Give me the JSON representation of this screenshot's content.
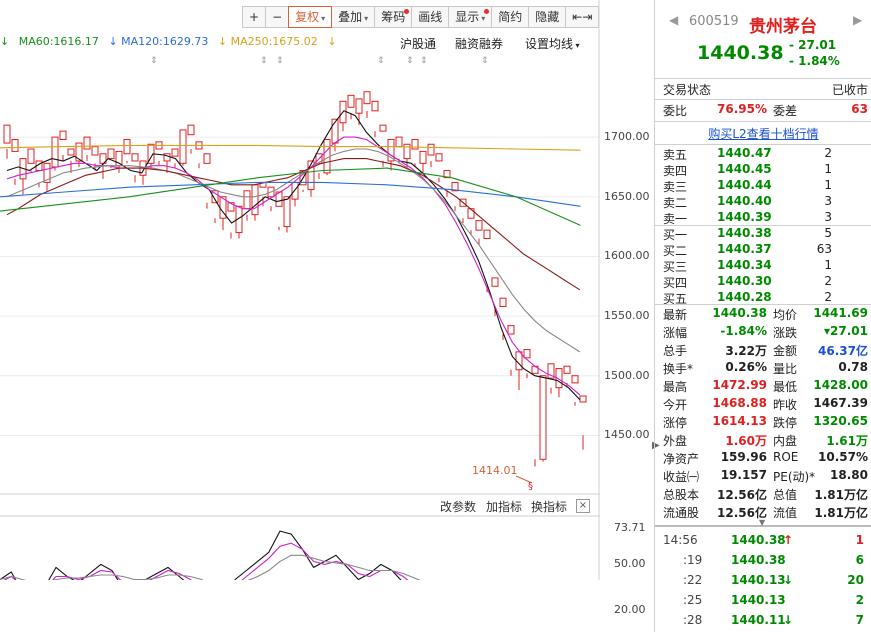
{
  "toolbar": {
    "buttons": [
      {
        "label": "+",
        "arrow": false,
        "dot": false,
        "selected": false
      },
      {
        "label": "−",
        "arrow": false,
        "dot": false,
        "selected": false
      },
      {
        "label": "复权",
        "arrow": true,
        "dot": false,
        "selected": true
      },
      {
        "label": "叠加",
        "arrow": true,
        "dot": false,
        "selected": false
      },
      {
        "label": "筹码",
        "arrow": false,
        "dot": true,
        "selected": false
      },
      {
        "label": "画线",
        "arrow": false,
        "dot": false,
        "selected": false
      },
      {
        "label": "显示",
        "arrow": true,
        "dot": true,
        "selected": false
      },
      {
        "label": "简约",
        "arrow": false,
        "dot": false,
        "selected": false
      },
      {
        "label": "隐藏",
        "arrow": false,
        "dot": false,
        "selected": false
      },
      {
        "label": "⇤⇥",
        "arrow": false,
        "dot": false,
        "selected": false
      }
    ]
  },
  "ma": {
    "ma60": "MA60:1616.17",
    "ma120": "MA120:1629.73",
    "ma250": "MA250:1675.02",
    "ma120_arrow": "↓",
    "ma250_arrow": "↓",
    "colors": {
      "ma60": "#1a8f1a",
      "ma120": "#2b6fd6",
      "ma250": "#d9a21a"
    }
  },
  "links": {
    "hugutong": "沪股通",
    "rongzi": "融资融券",
    "setting": "设置均线"
  },
  "sub_toolbar": {
    "params": "改参数",
    "add": "加指标",
    "switch": "换指标",
    "close": "×"
  },
  "chart_data": [
    {
      "type": "candlestick",
      "title": "",
      "ylim": [
        1414,
        1733
      ],
      "y_ticks": [
        "1700.00",
        "1650.00",
        "1600.00",
        "1550.00",
        "1500.00",
        "1450.00"
      ],
      "annotation": "1414.01",
      "candles": [
        [
          1685,
          1700,
          1672,
          1680
        ],
        [
          1678,
          1688,
          1650,
          1655
        ],
        [
          1655,
          1672,
          1642,
          1668
        ],
        [
          1668,
          1680,
          1660,
          1662
        ],
        [
          1662,
          1670,
          1648,
          1652
        ],
        [
          1652,
          1668,
          1645,
          1665
        ],
        [
          1665,
          1690,
          1662,
          1688
        ],
        [
          1688,
          1695,
          1670,
          1675
        ],
        [
          1675,
          1680,
          1660,
          1670
        ],
        [
          1670,
          1685,
          1665,
          1680
        ],
        [
          1680,
          1690,
          1670,
          1675
        ],
        [
          1675,
          1682,
          1662,
          1668
        ],
        [
          1668,
          1676,
          1655,
          1672
        ],
        [
          1672,
          1680,
          1664,
          1666
        ],
        [
          1666,
          1678,
          1660,
          1676
        ],
        [
          1676,
          1688,
          1668,
          1670
        ],
        [
          1670,
          1676,
          1652,
          1658
        ],
        [
          1658,
          1670,
          1650,
          1668
        ],
        [
          1668,
          1684,
          1664,
          1680
        ],
        [
          1680,
          1686,
          1666,
          1670
        ],
        [
          1670,
          1676,
          1660,
          1674
        ],
        [
          1674,
          1680,
          1664,
          1668
        ],
        [
          1668,
          1696,
          1666,
          1692
        ],
        [
          1692,
          1700,
          1676,
          1680
        ],
        [
          1680,
          1686,
          1664,
          1668
        ],
        [
          1668,
          1676,
          1630,
          1635
        ],
        [
          1635,
          1645,
          1618,
          1622
        ],
        [
          1622,
          1640,
          1612,
          1628
        ],
        [
          1628,
          1635,
          1605,
          1610
        ],
        [
          1610,
          1632,
          1605,
          1630
        ],
        [
          1630,
          1645,
          1620,
          1625
        ],
        [
          1625,
          1650,
          1620,
          1648
        ],
        [
          1648,
          1652,
          1632,
          1640
        ],
        [
          1640,
          1648,
          1628,
          1632
        ],
        [
          1632,
          1644,
          1612,
          1615
        ],
        [
          1615,
          1640,
          1610,
          1638
        ],
        [
          1638,
          1652,
          1632,
          1650
        ],
        [
          1650,
          1662,
          1644,
          1646
        ],
        [
          1646,
          1670,
          1640,
          1668
        ],
        [
          1668,
          1676,
          1655,
          1660
        ],
        [
          1660,
          1688,
          1658,
          1685
        ],
        [
          1685,
          1705,
          1678,
          1702
        ],
        [
          1702,
          1720,
          1695,
          1715
        ],
        [
          1715,
          1725,
          1705,
          1710
        ],
        [
          1710,
          1722,
          1700,
          1718
        ],
        [
          1718,
          1728,
          1706,
          1712
        ],
        [
          1712,
          1720,
          1690,
          1695
        ],
        [
          1695,
          1700,
          1665,
          1670
        ],
        [
          1670,
          1688,
          1662,
          1682
        ],
        [
          1682,
          1690,
          1668,
          1672
        ],
        [
          1672,
          1684,
          1664,
          1680
        ],
        [
          1680,
          1688,
          1665,
          1668
        ],
        [
          1668,
          1678,
          1660,
          1675
        ],
        [
          1675,
          1684,
          1665,
          1670
        ],
        [
          1670,
          1676,
          1652,
          1656
        ],
        [
          1656,
          1662,
          1640,
          1645
        ],
        [
          1645,
          1652,
          1628,
          1632
        ],
        [
          1632,
          1638,
          1618,
          1622
        ],
        [
          1622,
          1630,
          1608,
          1612
        ],
        [
          1612,
          1620,
          1600,
          1605
        ],
        [
          1605,
          1612,
          1560,
          1565
        ],
        [
          1565,
          1572,
          1540,
          1548
        ],
        [
          1548,
          1555,
          1520,
          1525
        ],
        [
          1525,
          1532,
          1490,
          1495
        ],
        [
          1495,
          1510,
          1478,
          1505
        ],
        [
          1505,
          1512,
          1488,
          1492
        ],
        [
          1492,
          1498,
          1414,
          1420
        ],
        [
          1420,
          1490,
          1418,
          1488
        ],
        [
          1488,
          1500,
          1475,
          1480
        ],
        [
          1480,
          1496,
          1472,
          1492
        ],
        [
          1492,
          1498,
          1480,
          1484
        ],
        [
          1484,
          1490,
          1465,
          1468
        ],
        [
          1468,
          1473,
          1428,
          1440
        ]
      ],
      "lines": [
        {
          "name": "MA5",
          "color": "#111111",
          "values": [
            1662,
            1665,
            1662,
            1668,
            1672,
            1670,
            1674,
            1668,
            1662,
            1672,
            1668,
            1662,
            1660,
            1676,
            1675,
            1672,
            1660,
            1652,
            1646,
            1630,
            1618,
            1624,
            1632,
            1640,
            1636,
            1638,
            1650,
            1666,
            1684,
            1700,
            1712,
            1708,
            1694,
            1684,
            1676,
            1670,
            1668,
            1660,
            1650,
            1638,
            1624,
            1606,
            1586,
            1560,
            1530,
            1506,
            1496,
            1490,
            1488,
            1486,
            1480,
            1470
          ]
        },
        {
          "name": "MA10",
          "color": "#d020d0",
          "values": [
            1655,
            1658,
            1660,
            1662,
            1664,
            1666,
            1668,
            1668,
            1666,
            1666,
            1664,
            1664,
            1664,
            1666,
            1666,
            1664,
            1660,
            1654,
            1646,
            1640,
            1634,
            1630,
            1630,
            1636,
            1642,
            1648,
            1656,
            1664,
            1674,
            1684,
            1690,
            1690,
            1688,
            1682,
            1676,
            1670,
            1664,
            1656,
            1646,
            1634,
            1618,
            1600,
            1580,
            1558,
            1536,
            1518,
            1506,
            1498,
            1492,
            1488,
            1482,
            1474
          ]
        },
        {
          "name": "MA20",
          "color": "#888888",
          "values": [
            1640,
            1644,
            1648,
            1652,
            1656,
            1660,
            1662,
            1664,
            1665,
            1666,
            1666,
            1666,
            1665,
            1664,
            1662,
            1660,
            1656,
            1652,
            1648,
            1644,
            1642,
            1640,
            1640,
            1642,
            1646,
            1652,
            1658,
            1664,
            1670,
            1675,
            1678,
            1680,
            1680,
            1678,
            1674,
            1668,
            1662,
            1655,
            1646,
            1636,
            1624,
            1612,
            1600,
            1586,
            1572,
            1558,
            1546,
            1536,
            1528,
            1522,
            1516,
            1510
          ]
        },
        {
          "name": "MA30",
          "color": "#8b1a1a",
          "values": [
            1625,
            1630,
            1636,
            1642,
            1646,
            1650,
            1654,
            1658,
            1660,
            1662,
            1664,
            1664,
            1664,
            1663,
            1662,
            1660,
            1658,
            1656,
            1654,
            1652,
            1650,
            1650,
            1650,
            1652,
            1654,
            1656,
            1660,
            1664,
            1668,
            1670,
            1672,
            1672,
            1672,
            1670,
            1668,
            1666,
            1662,
            1658,
            1652,
            1646,
            1640,
            1632,
            1624,
            1616,
            1608,
            1600,
            1592,
            1586,
            1580,
            1574,
            1568,
            1562
          ]
        }
      ]
    },
    {
      "type": "line",
      "title": "",
      "ylim": [
        5,
        80
      ],
      "y_ticks": [
        "73.71",
        "50.00",
        "20.00"
      ],
      "lines": [
        {
          "name": "",
          "color": "#111111",
          "values": [
            40,
            45,
            32,
            28,
            35,
            48,
            42,
            38,
            44,
            50,
            46,
            34,
            30,
            40,
            44,
            48,
            42,
            36,
            28,
            22,
            30,
            40,
            46,
            52,
            58,
            72,
            70,
            60,
            48,
            52,
            56,
            48,
            40,
            44,
            50,
            46,
            38,
            32,
            30,
            34,
            30,
            24,
            18,
            12,
            10,
            14,
            18,
            22,
            26,
            24,
            20,
            14
          ]
        },
        {
          "name": "",
          "color": "#d020d0",
          "values": [
            38,
            42,
            36,
            32,
            34,
            42,
            42,
            40,
            42,
            46,
            45,
            38,
            34,
            38,
            42,
            46,
            44,
            40,
            34,
            28,
            30,
            36,
            42,
            48,
            54,
            62,
            64,
            60,
            52,
            50,
            52,
            50,
            44,
            42,
            46,
            46,
            42,
            36,
            32,
            32,
            30,
            26,
            22,
            18,
            16,
            18,
            20,
            22,
            24,
            24,
            22,
            18
          ]
        },
        {
          "name": "",
          "color": "#888888",
          "values": [
            40,
            42,
            40,
            38,
            38,
            40,
            41,
            41,
            42,
            43,
            43,
            42,
            40,
            40,
            41,
            43,
            43,
            42,
            40,
            36,
            35,
            36,
            39,
            42,
            46,
            52,
            56,
            56,
            54,
            52,
            51,
            50,
            48,
            46,
            46,
            46,
            44,
            41,
            38,
            36,
            34,
            32,
            29,
            27,
            25,
            24,
            24,
            24,
            24,
            24,
            24,
            23
          ]
        }
      ]
    }
  ],
  "quote": {
    "code": "600519",
    "name": "贵州茅台",
    "price": "1440.38",
    "change": "- 27.01",
    "change_pct": "- 1.84%",
    "status_label": "交易状态",
    "status_value": "已收市",
    "webi_label": "委比",
    "webi_value": "76.95%",
    "weicha_label": "委差",
    "weicha_value": "63",
    "l2_link": "购买L2查看十档行情"
  },
  "sells": [
    {
      "label": "卖五",
      "price": "1440.47",
      "vol": "2"
    },
    {
      "label": "卖四",
      "price": "1440.45",
      "vol": "1"
    },
    {
      "label": "卖三",
      "price": "1440.44",
      "vol": "1"
    },
    {
      "label": "卖二",
      "price": "1440.40",
      "vol": "3"
    },
    {
      "label": "卖一",
      "price": "1440.39",
      "vol": "3"
    }
  ],
  "buys": [
    {
      "label": "买一",
      "price": "1440.38",
      "vol": "5"
    },
    {
      "label": "买二",
      "price": "1440.37",
      "vol": "63"
    },
    {
      "label": "买三",
      "price": "1440.34",
      "vol": "1"
    },
    {
      "label": "买四",
      "price": "1440.30",
      "vol": "2"
    },
    {
      "label": "买五",
      "price": "1440.28",
      "vol": "2"
    }
  ],
  "stats": [
    {
      "l1": "最新",
      "v1": "1440.38",
      "c1": "green",
      "l2": "均价",
      "v2": "1441.69",
      "c2": "green"
    },
    {
      "l1": "涨幅",
      "v1": "-1.84%",
      "c1": "green",
      "l2": "涨跌",
      "v2": "▾27.01",
      "c2": "green"
    },
    {
      "l1": "总手",
      "v1": "3.22万",
      "c1": "black",
      "l2": "金额",
      "v2": "46.37亿",
      "c2": "blue"
    },
    {
      "l1": "换手*",
      "v1": "0.26%",
      "c1": "black",
      "l2": "量比",
      "v2": "0.78",
      "c2": "black"
    },
    {
      "l1": "最高",
      "v1": "1472.99",
      "c1": "red",
      "l2": "最低",
      "v2": "1428.00",
      "c2": "green"
    },
    {
      "l1": "今开",
      "v1": "1468.88",
      "c1": "red",
      "l2": "昨收",
      "v2": "1467.39",
      "c2": "black"
    },
    {
      "l1": "涨停",
      "v1": "1614.13",
      "c1": "red",
      "l2": "跌停",
      "v2": "1320.65",
      "c2": "green"
    },
    {
      "l1": "外盘",
      "v1": "1.60万",
      "c1": "red",
      "l2": "内盘",
      "v2": "1.61万",
      "c2": "green"
    },
    {
      "l1": "净资产",
      "v1": "159.96",
      "c1": "black",
      "l2": "ROE",
      "v2": "10.57%",
      "c2": "black"
    },
    {
      "l1": "收益㈠",
      "v1": "19.157",
      "c1": "black",
      "l2": "PE(动)*",
      "v2": "18.80",
      "c2": "black"
    },
    {
      "l1": "总股本",
      "v1": "12.56亿",
      "c1": "black",
      "l2": "总值",
      "v2": "1.81万亿",
      "c2": "black"
    },
    {
      "l1": "流通股",
      "v1": "12.56亿",
      "c1": "black",
      "l2": "流值",
      "v2": "1.81万亿",
      "c2": "black"
    }
  ],
  "ticks": [
    {
      "time": "14:56",
      "price": "1440.38",
      "dir": "up",
      "vol": "1"
    },
    {
      "time": ":19",
      "price": "1440.38",
      "dir": "",
      "vol": "6"
    },
    {
      "time": ":22",
      "price": "1440.13",
      "dir": "down",
      "vol": "20"
    },
    {
      "time": ":25",
      "price": "1440.13",
      "dir": "",
      "vol": "2"
    },
    {
      "time": ":28",
      "price": "1440.11",
      "dir": "down",
      "vol": "7"
    }
  ],
  "colors": {
    "up": "#e02020",
    "down": "#008a00",
    "accent": "#d9603a"
  }
}
